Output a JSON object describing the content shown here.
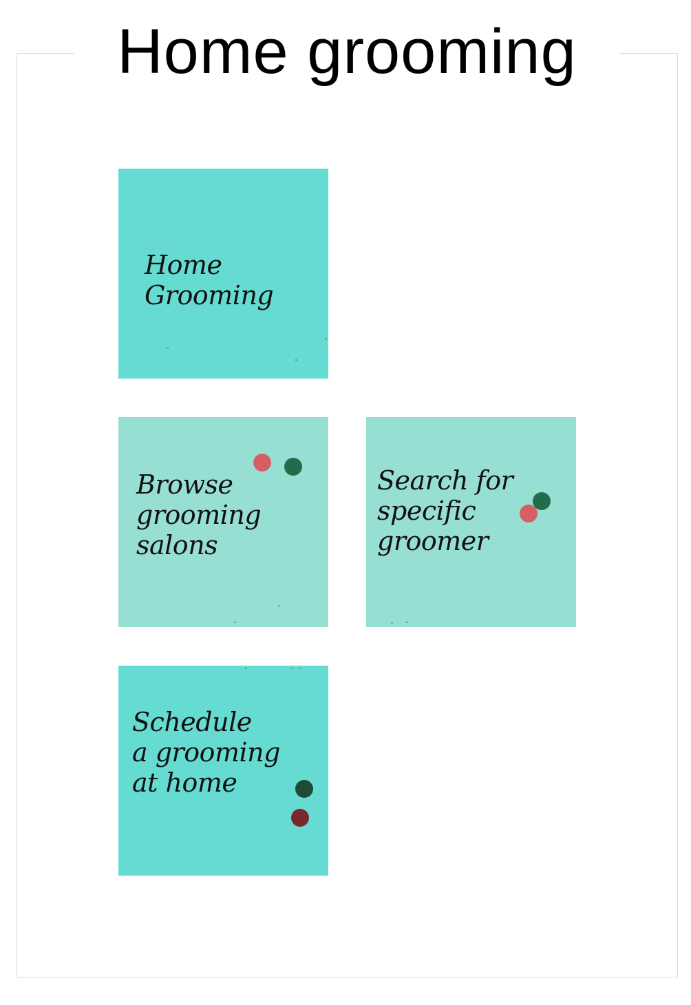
{
  "page": {
    "title": "Home grooming"
  },
  "notes": [
    {
      "text": "Home\nGrooming",
      "color": "#65dbd1",
      "dots": []
    },
    {
      "text": "Browse\ngrooming\nsalons",
      "color": "#97dfd3",
      "dots": [
        "#d65f66",
        "#236b4a"
      ]
    },
    {
      "text": "Search for\nspecific\ngroomer",
      "color": "#97dfd3",
      "dots": [
        "#236b4a",
        "#d65f66"
      ]
    },
    {
      "text": "Schedule\na grooming\nat home",
      "color": "#65dbd1",
      "dots": [
        "#1e4a36",
        "#7a2730"
      ]
    }
  ],
  "colors": {
    "note_teal": "#65dbd1",
    "note_pale": "#97dfd3",
    "dot_red": "#d65f66",
    "dot_green": "#236b4a",
    "dot_dark_green": "#1e4a36",
    "dot_dark_red": "#7a2730"
  }
}
